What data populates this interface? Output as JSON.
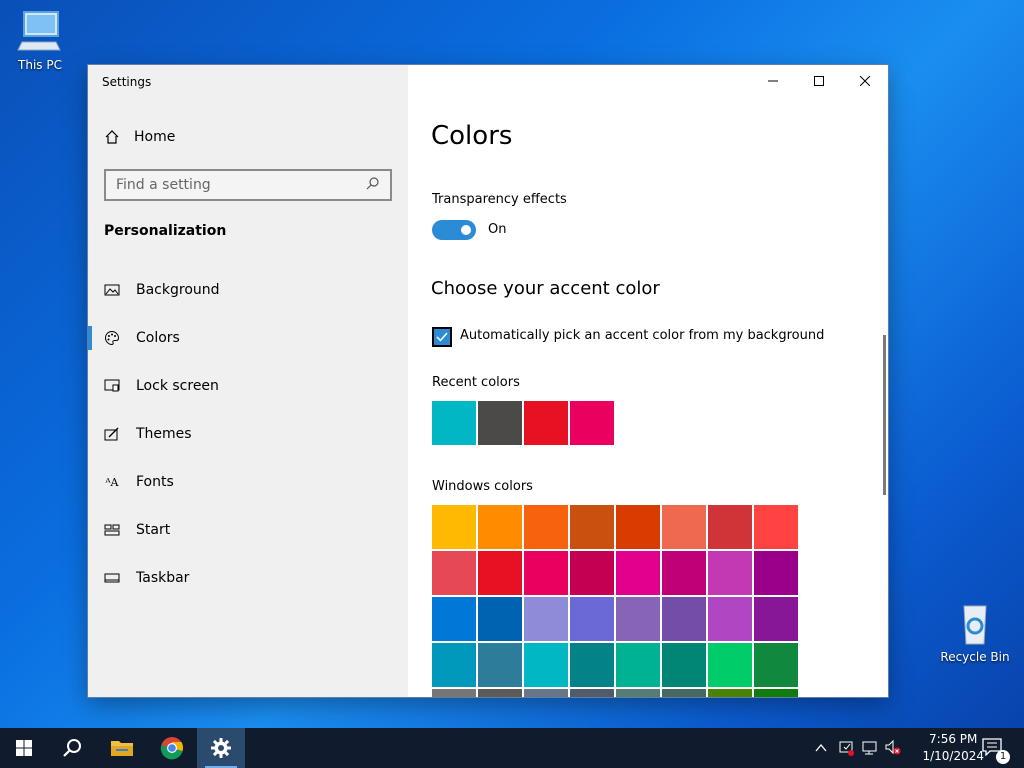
{
  "desktop": {
    "icons": [
      {
        "label": "This PC"
      },
      {
        "label": "Recycle Bin"
      }
    ]
  },
  "window": {
    "title": "Settings",
    "controls": {
      "minimize": "minimize-icon",
      "maximize": "maximize-icon",
      "close": "close-icon"
    }
  },
  "sidebar": {
    "home_label": "Home",
    "search_placeholder": "Find a setting",
    "section_title": "Personalization",
    "items": [
      {
        "label": "Background",
        "icon": "picture-icon"
      },
      {
        "label": "Colors",
        "icon": "palette-icon",
        "active": true
      },
      {
        "label": "Lock screen",
        "icon": "lock-screen-icon"
      },
      {
        "label": "Themes",
        "icon": "themes-icon"
      },
      {
        "label": "Fonts",
        "icon": "fonts-icon"
      },
      {
        "label": "Start",
        "icon": "start-icon"
      },
      {
        "label": "Taskbar",
        "icon": "taskbar-icon"
      }
    ]
  },
  "content": {
    "title": "Colors",
    "transparency": {
      "label": "Transparency effects",
      "state": "On"
    },
    "accent_heading": "Choose your accent color",
    "auto_pick_label": "Automatically pick an accent color from my background",
    "auto_pick_checked": true,
    "recent_label": "Recent colors",
    "recent_colors": [
      "#00b7c3",
      "#4c4a48",
      "#e81123",
      "#ea005e"
    ],
    "windows_label": "Windows colors",
    "windows_colors": [
      "#ffb900",
      "#ff8c00",
      "#f7630c",
      "#ca5010",
      "#da3b01",
      "#ef6950",
      "#d13438",
      "#ff4343",
      "#e74856",
      "#e81123",
      "#ea005e",
      "#c30052",
      "#e3008c",
      "#bf0077",
      "#c239b3",
      "#9a0089",
      "#0078d7",
      "#0063b1",
      "#8e8cd8",
      "#6b69d6",
      "#8764b8",
      "#744da9",
      "#b146c2",
      "#881798",
      "#0099bc",
      "#2d7d9a",
      "#00b7c3",
      "#038387",
      "#00b294",
      "#018574",
      "#00cc6a",
      "#10893e",
      "#7a7574",
      "#5d5a58",
      "#68768a",
      "#515c6b",
      "#567c73",
      "#486860",
      "#498205",
      "#107c10"
    ]
  },
  "taskbar": {
    "apps": [
      {
        "name": "start-button"
      },
      {
        "name": "search-button"
      },
      {
        "name": "file-explorer-button"
      },
      {
        "name": "chrome-button"
      },
      {
        "name": "settings-button",
        "active": true
      }
    ],
    "time": "7:56 PM",
    "date": "1/10/2024",
    "notification_count": "1"
  }
}
